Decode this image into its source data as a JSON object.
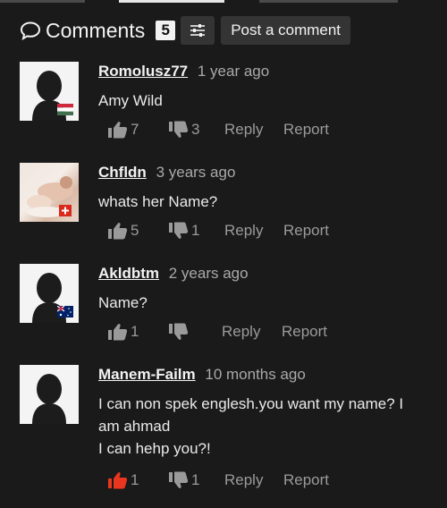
{
  "header": {
    "title": "Comments",
    "count": "5",
    "post_label": "Post a comment"
  },
  "colors": {
    "accent": "#e8361f",
    "background": "#1a1a1a",
    "muted": "#9a9a9a"
  },
  "comments": [
    {
      "username": "Romolusz77",
      "time": "1 year ago",
      "text": "Amy Wild",
      "likes": "7",
      "dislikes": "3",
      "reply": "Reply",
      "report": "Report",
      "flag": "hungary-flag",
      "liked": false
    },
    {
      "username": "Chfldn",
      "time": "3 years ago",
      "text": "whats her Name?",
      "likes": "5",
      "dislikes": "1",
      "reply": "Reply",
      "report": "Report",
      "flag": "switzerland-flag",
      "liked": false
    },
    {
      "username": "Akldbtm",
      "time": "2 years ago",
      "text": "Name?",
      "likes": "1",
      "dislikes": "",
      "reply": "Reply",
      "report": "Report",
      "flag": "australia-flag",
      "liked": false
    },
    {
      "username": "Manem-Failm",
      "time": "10 months ago",
      "text": "I can non spek englesh.you want my name? I am ahmad",
      "text2": "I can hehp you?!",
      "likes": "1",
      "dislikes": "1",
      "reply": "Reply",
      "report": "Report",
      "liked": true
    }
  ]
}
